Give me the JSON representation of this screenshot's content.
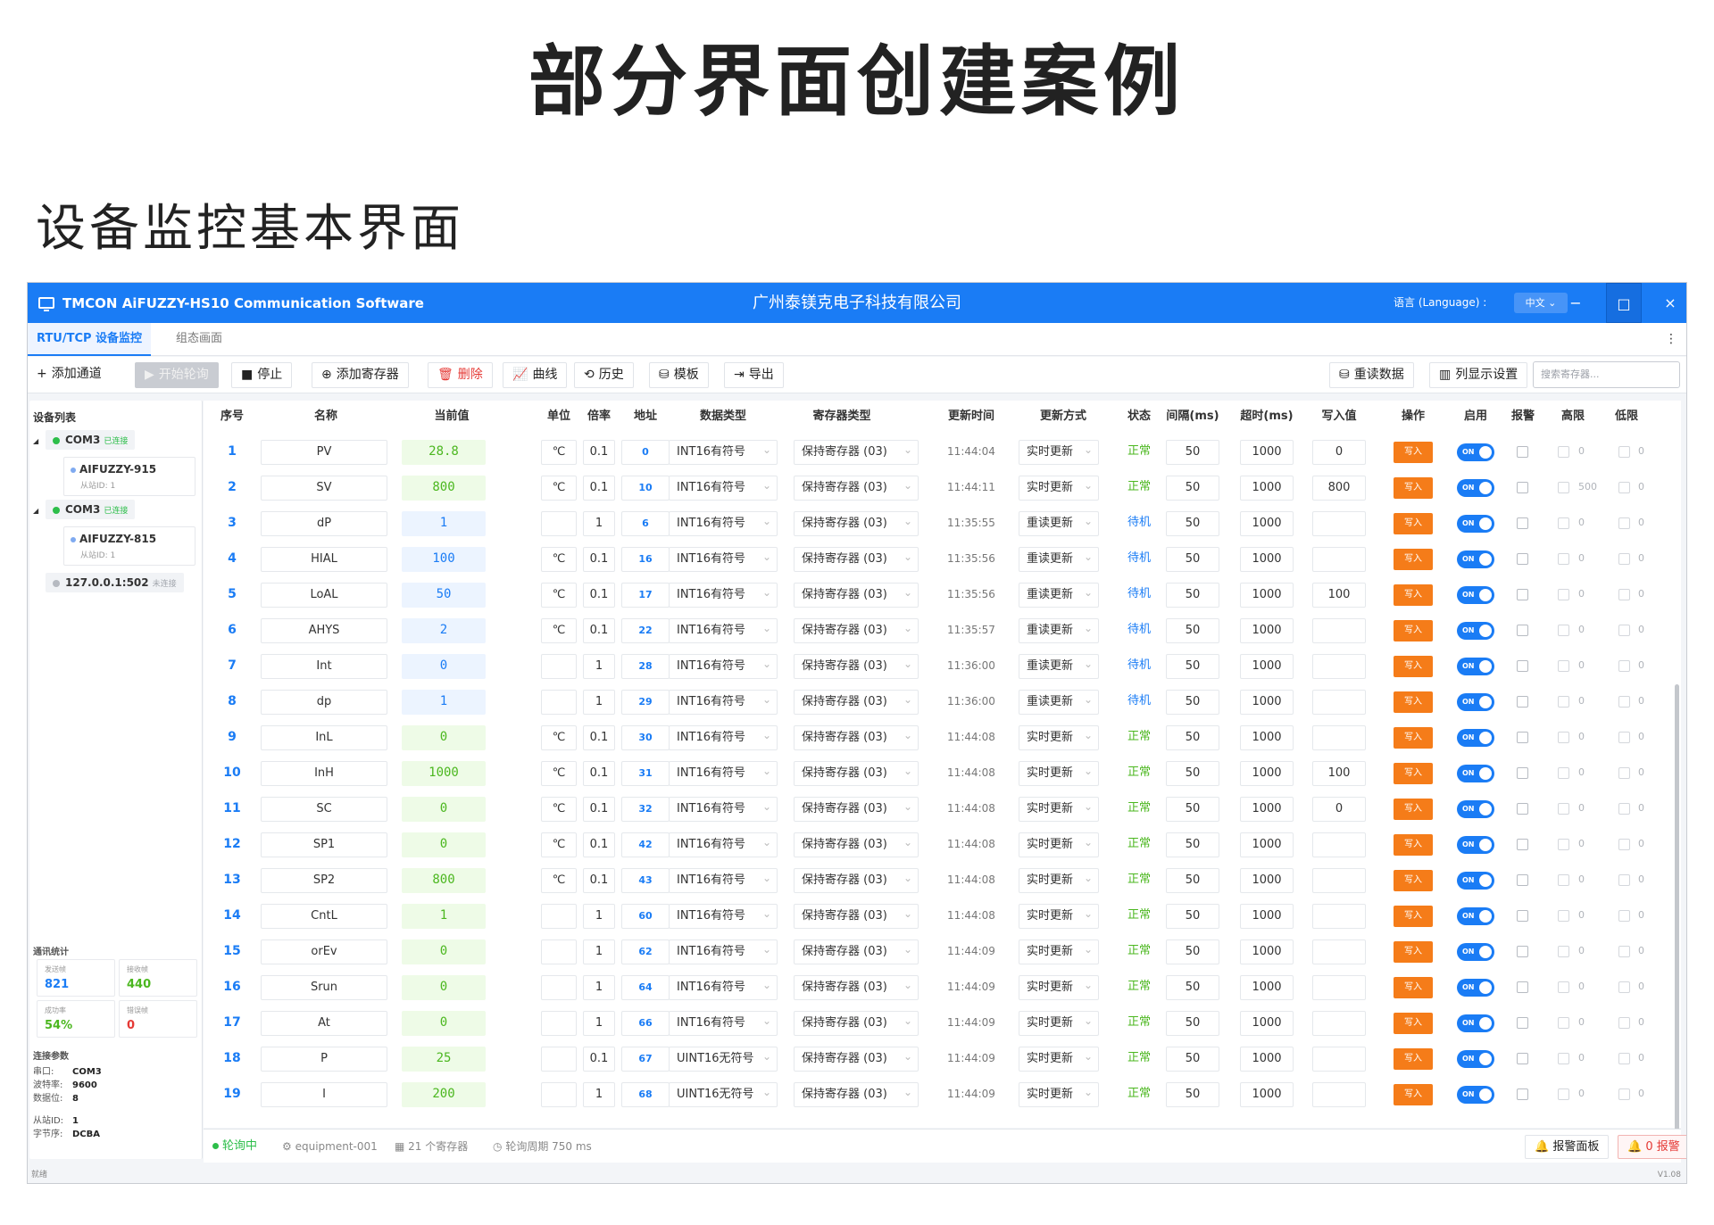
{
  "heading": {
    "main": "部分界面创建案例",
    "sub": "设备监控基本界面"
  },
  "window": {
    "app_title": "TMCON AiFUZZY-HS10 Communication Software",
    "company": "广州泰镁克电子科技有限公司",
    "language_label": "语言 (Language) :",
    "language_value": "中文 ⌄",
    "minimize": "−",
    "maximize": "□",
    "close": "×"
  },
  "tabs": [
    "RTU/TCP 设备监控",
    "组态画面"
  ],
  "menu_dots": "⋮",
  "toolbar": {
    "add_channel": "添加通道",
    "start_poll": "开始轮询",
    "stop": "停止",
    "add_register": "添加寄存器",
    "delete": "删除",
    "curve": "曲线",
    "history": "历史",
    "template": "模板",
    "export": "导出",
    "reread": "重读数据",
    "columns": "列显示设置",
    "search_placeholder": "搜索寄存器..."
  },
  "icons": {
    "plus": "+",
    "play": "▶",
    "stop": "■",
    "plusc": "⊕",
    "trash": "🗑",
    "chart": "📈",
    "hist": "⟲",
    "tpl": "⛁",
    "exp": "⇥",
    "db": "⛁",
    "cols": "▥",
    "gear": "⚙",
    "grid": "▦",
    "clock": "◷",
    "bell": "🔔"
  },
  "sidebar": {
    "title": "设备列表",
    "nodes": [
      {
        "name": "COM3",
        "status": "已连接",
        "devices": [
          {
            "name": "AIFUZZY-915",
            "slave": "从站ID: 1"
          }
        ]
      },
      {
        "name": "COM3",
        "status": "已连接",
        "devices": [
          {
            "name": "AIFUZZY-815",
            "slave": "从站ID: 1"
          }
        ]
      },
      {
        "name": "127.0.0.1:502",
        "status": "未连接",
        "devices": []
      }
    ],
    "stats_title": "通讯统计",
    "stats": [
      {
        "label": "发送帧",
        "value": "821",
        "color": "#1a7cf5"
      },
      {
        "label": "接收帧",
        "value": "440",
        "color": "#4bb71f"
      },
      {
        "label": "成功率",
        "value": "54%",
        "color": "#4bb71f"
      },
      {
        "label": "错误帧",
        "value": "0",
        "color": "#e53935"
      }
    ],
    "conn_title": "连接参数",
    "conn": [
      {
        "k": "串口:",
        "v": "COM3"
      },
      {
        "k": "波特率:",
        "v": "9600"
      },
      {
        "k": "数据位:",
        "v": "8"
      }
    ],
    "conn2": [
      {
        "k": "从站ID:",
        "v": "1"
      },
      {
        "k": "字节序:",
        "v": "DCBA"
      }
    ]
  },
  "table": {
    "headers": [
      "序号",
      "名称",
      "当前值",
      "单位",
      "倍率",
      "地址",
      "数据类型",
      "寄存器类型",
      "更新时间",
      "更新方式",
      "状态",
      "间隔(ms)",
      "超时(ms)",
      "写入值",
      "操作",
      "启用",
      "报警",
      "高限",
      "低限"
    ],
    "write_label": "写入",
    "rows": [
      {
        "n": "1",
        "name": "PV",
        "val": "28.8",
        "vc": "gr",
        "unit": "℃",
        "rate": "0.1",
        "addr": "0",
        "dtype": "INT16有符号",
        "rtype": "保持寄存器 (03)",
        "time": "11:44:04",
        "mode": "实时更新",
        "status": "正常",
        "sc": "ok",
        "interval": "50",
        "timeout": "1000",
        "write": "0",
        "high": "0",
        "low": "0"
      },
      {
        "n": "2",
        "name": "SV",
        "val": "800",
        "vc": "gr",
        "unit": "℃",
        "rate": "0.1",
        "addr": "10",
        "dtype": "INT16有符号",
        "rtype": "保持寄存器 (03)",
        "time": "11:44:11",
        "mode": "实时更新",
        "status": "正常",
        "sc": "ok",
        "interval": "50",
        "timeout": "1000",
        "write": "800",
        "high": "500",
        "low": "0"
      },
      {
        "n": "3",
        "name": "dP",
        "val": "1",
        "vc": "bl",
        "unit": "",
        "rate": "1",
        "addr": "6",
        "dtype": "INT16有符号",
        "rtype": "保持寄存器 (03)",
        "time": "11:35:55",
        "mode": "重读更新",
        "status": "待机",
        "sc": "wt",
        "interval": "50",
        "timeout": "1000",
        "write": "",
        "high": "0",
        "low": "0"
      },
      {
        "n": "4",
        "name": "HIAL",
        "val": "100",
        "vc": "bl",
        "unit": "℃",
        "rate": "0.1",
        "addr": "16",
        "dtype": "INT16有符号",
        "rtype": "保持寄存器 (03)",
        "time": "11:35:56",
        "mode": "重读更新",
        "status": "待机",
        "sc": "wt",
        "interval": "50",
        "timeout": "1000",
        "write": "",
        "high": "0",
        "low": "0"
      },
      {
        "n": "5",
        "name": "LoAL",
        "val": "50",
        "vc": "bl",
        "unit": "℃",
        "rate": "0.1",
        "addr": "17",
        "dtype": "INT16有符号",
        "rtype": "保持寄存器 (03)",
        "time": "11:35:56",
        "mode": "重读更新",
        "status": "待机",
        "sc": "wt",
        "interval": "50",
        "timeout": "1000",
        "write": "100",
        "high": "0",
        "low": "0"
      },
      {
        "n": "6",
        "name": "AHYS",
        "val": "2",
        "vc": "bl",
        "unit": "℃",
        "rate": "0.1",
        "addr": "22",
        "dtype": "INT16有符号",
        "rtype": "保持寄存器 (03)",
        "time": "11:35:57",
        "mode": "重读更新",
        "status": "待机",
        "sc": "wt",
        "interval": "50",
        "timeout": "1000",
        "write": "",
        "high": "0",
        "low": "0"
      },
      {
        "n": "7",
        "name": "Int",
        "val": "0",
        "vc": "bl",
        "unit": "",
        "rate": "1",
        "addr": "28",
        "dtype": "INT16有符号",
        "rtype": "保持寄存器 (03)",
        "time": "11:36:00",
        "mode": "重读更新",
        "status": "待机",
        "sc": "wt",
        "interval": "50",
        "timeout": "1000",
        "write": "",
        "high": "0",
        "low": "0"
      },
      {
        "n": "8",
        "name": "dp",
        "val": "1",
        "vc": "bl",
        "unit": "",
        "rate": "1",
        "addr": "29",
        "dtype": "INT16有符号",
        "rtype": "保持寄存器 (03)",
        "time": "11:36:00",
        "mode": "重读更新",
        "status": "待机",
        "sc": "wt",
        "interval": "50",
        "timeout": "1000",
        "write": "",
        "high": "0",
        "low": "0"
      },
      {
        "n": "9",
        "name": "InL",
        "val": "0",
        "vc": "gr",
        "unit": "℃",
        "rate": "0.1",
        "addr": "30",
        "dtype": "INT16有符号",
        "rtype": "保持寄存器 (03)",
        "time": "11:44:08",
        "mode": "实时更新",
        "status": "正常",
        "sc": "ok",
        "interval": "50",
        "timeout": "1000",
        "write": "",
        "high": "0",
        "low": "0"
      },
      {
        "n": "10",
        "name": "InH",
        "val": "1000",
        "vc": "gr",
        "unit": "℃",
        "rate": "0.1",
        "addr": "31",
        "dtype": "INT16有符号",
        "rtype": "保持寄存器 (03)",
        "time": "11:44:08",
        "mode": "实时更新",
        "status": "正常",
        "sc": "ok",
        "interval": "50",
        "timeout": "1000",
        "write": "100",
        "high": "0",
        "low": "0"
      },
      {
        "n": "11",
        "name": "SC",
        "val": "0",
        "vc": "gr",
        "unit": "℃",
        "rate": "0.1",
        "addr": "32",
        "dtype": "INT16有符号",
        "rtype": "保持寄存器 (03)",
        "time": "11:44:08",
        "mode": "实时更新",
        "status": "正常",
        "sc": "ok",
        "interval": "50",
        "timeout": "1000",
        "write": "0",
        "high": "0",
        "low": "0"
      },
      {
        "n": "12",
        "name": "SP1",
        "val": "0",
        "vc": "gr",
        "unit": "℃",
        "rate": "0.1",
        "addr": "42",
        "dtype": "INT16有符号",
        "rtype": "保持寄存器 (03)",
        "time": "11:44:08",
        "mode": "实时更新",
        "status": "正常",
        "sc": "ok",
        "interval": "50",
        "timeout": "1000",
        "write": "",
        "high": "0",
        "low": "0"
      },
      {
        "n": "13",
        "name": "SP2",
        "val": "800",
        "vc": "gr",
        "unit": "℃",
        "rate": "0.1",
        "addr": "43",
        "dtype": "INT16有符号",
        "rtype": "保持寄存器 (03)",
        "time": "11:44:08",
        "mode": "实时更新",
        "status": "正常",
        "sc": "ok",
        "interval": "50",
        "timeout": "1000",
        "write": "",
        "high": "0",
        "low": "0"
      },
      {
        "n": "14",
        "name": "CntL",
        "val": "1",
        "vc": "gr",
        "unit": "",
        "rate": "1",
        "addr": "60",
        "dtype": "INT16有符号",
        "rtype": "保持寄存器 (03)",
        "time": "11:44:08",
        "mode": "实时更新",
        "status": "正常",
        "sc": "ok",
        "interval": "50",
        "timeout": "1000",
        "write": "",
        "high": "0",
        "low": "0"
      },
      {
        "n": "15",
        "name": "orEv",
        "val": "0",
        "vc": "gr",
        "unit": "",
        "rate": "1",
        "addr": "62",
        "dtype": "INT16有符号",
        "rtype": "保持寄存器 (03)",
        "time": "11:44:09",
        "mode": "实时更新",
        "status": "正常",
        "sc": "ok",
        "interval": "50",
        "timeout": "1000",
        "write": "",
        "high": "0",
        "low": "0"
      },
      {
        "n": "16",
        "name": "Srun",
        "val": "0",
        "vc": "gr",
        "unit": "",
        "rate": "1",
        "addr": "64",
        "dtype": "INT16有符号",
        "rtype": "保持寄存器 (03)",
        "time": "11:44:09",
        "mode": "实时更新",
        "status": "正常",
        "sc": "ok",
        "interval": "50",
        "timeout": "1000",
        "write": "",
        "high": "0",
        "low": "0"
      },
      {
        "n": "17",
        "name": "At",
        "val": "0",
        "vc": "gr",
        "unit": "",
        "rate": "1",
        "addr": "66",
        "dtype": "INT16有符号",
        "rtype": "保持寄存器 (03)",
        "time": "11:44:09",
        "mode": "实时更新",
        "status": "正常",
        "sc": "ok",
        "interval": "50",
        "timeout": "1000",
        "write": "",
        "high": "0",
        "low": "0"
      },
      {
        "n": "18",
        "name": "P",
        "val": "25",
        "vc": "gr",
        "unit": "",
        "rate": "0.1",
        "addr": "67",
        "dtype": "UINT16无符号",
        "rtype": "保持寄存器 (03)",
        "time": "11:44:09",
        "mode": "实时更新",
        "status": "正常",
        "sc": "ok",
        "interval": "50",
        "timeout": "1000",
        "write": "",
        "high": "0",
        "low": "0"
      },
      {
        "n": "19",
        "name": "I",
        "val": "200",
        "vc": "gr",
        "unit": "",
        "rate": "1",
        "addr": "68",
        "dtype": "UINT16无符号",
        "rtype": "保持寄存器 (03)",
        "time": "11:44:09",
        "mode": "实时更新",
        "status": "正常",
        "sc": "ok",
        "interval": "50",
        "timeout": "1000",
        "write": "",
        "high": "0",
        "low": "0"
      }
    ]
  },
  "statusbar": {
    "polling": "轮询中",
    "equipment": "equipment-001",
    "registers": "21 个寄存器",
    "period": "轮询周期 750 ms",
    "alarm_panel": "报警面板",
    "alarm_count": "0 报警"
  },
  "footer": {
    "left": "就绪",
    "right": "V1.08"
  },
  "colors": {
    "accent": "#1a7cf5",
    "ok": "#4bb71f",
    "write_btn": "#f57c19",
    "alarm": "#e53935"
  }
}
